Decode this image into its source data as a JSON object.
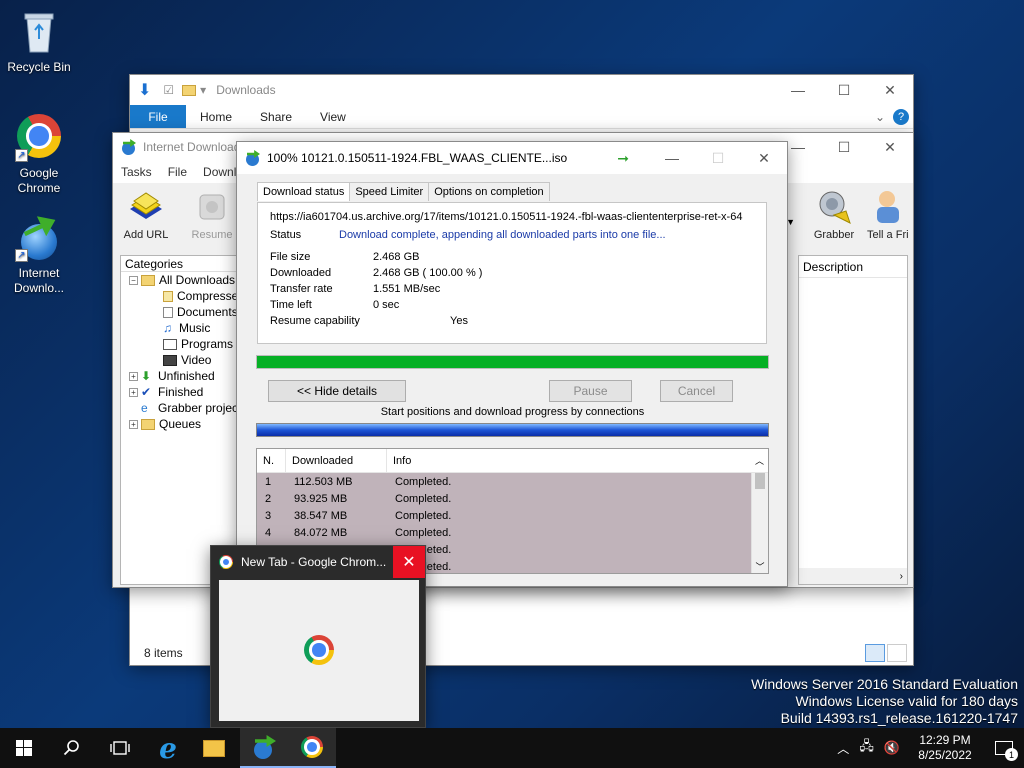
{
  "desktop": {
    "icons": [
      {
        "label": "Recycle Bin"
      },
      {
        "label": "Google Chrome"
      },
      {
        "label": "Internet Downlo..."
      }
    ]
  },
  "explorer": {
    "title": "Downloads",
    "ribbon": {
      "file": "File",
      "home": "Home",
      "share": "Share",
      "view": "View"
    },
    "status": "8 items"
  },
  "idm": {
    "title": "Internet Download",
    "menu": {
      "tasks": "Tasks",
      "file": "File",
      "downloads": "Downlo"
    },
    "toolbar": {
      "add_url": "Add URL",
      "resume": "Resume",
      "grabber": "Grabber",
      "tell_friend": "Tell a Fri"
    },
    "categories_label": "Categories",
    "tree": {
      "all": "All Downloads",
      "compressed": "Compresse",
      "documents": "Documents",
      "music": "Music",
      "programs": "Programs",
      "video": "Video",
      "unfinished": "Unfinished",
      "finished": "Finished",
      "grabber": "Grabber projec",
      "queues": "Queues"
    },
    "list_header": {
      "description": "Description"
    }
  },
  "dialog": {
    "title": "100% 10121.0.150511-1924.FBL_WAAS_CLIENTE...iso",
    "tabs": {
      "status": "Download status",
      "limiter": "Speed Limiter",
      "options": "Options on completion"
    },
    "url": "https://ia601704.us.archive.org/17/items/10121.0.150511-1924.-fbl-waas-cliententerprise-ret-x-64",
    "status_label": "Status",
    "status_value": "Download complete, appending all downloaded parts into one file...",
    "fields": {
      "file_size_label": "File size",
      "file_size_value": "2.468  GB",
      "downloaded_label": "Downloaded",
      "downloaded_value": "2.468  GB  ( 100.00 % )",
      "rate_label": "Transfer rate",
      "rate_value": "1.551  MB/sec",
      "time_label": "Time left",
      "time_value": "0 sec",
      "resume_label": "Resume capability",
      "resume_value": "Yes"
    },
    "progress": 1.0,
    "buttons": {
      "hide": "<< Hide details",
      "pause": "Pause",
      "cancel": "Cancel"
    },
    "connections_label": "Start positions and download progress by connections",
    "table": {
      "headers": {
        "n": "N.",
        "downloaded": "Downloaded",
        "info": "Info"
      },
      "rows": [
        {
          "n": "1",
          "downloaded": "112.503  MB",
          "info": "Completed."
        },
        {
          "n": "2",
          "downloaded": "93.925  MB",
          "info": "Completed."
        },
        {
          "n": "3",
          "downloaded": "38.547  MB",
          "info": "Completed."
        },
        {
          "n": "4",
          "downloaded": "84.072  MB",
          "info": "Completed."
        },
        {
          "n": "",
          "downloaded": "",
          "info": "Completed."
        },
        {
          "n": "",
          "downloaded": "",
          "info": "Completed."
        }
      ]
    }
  },
  "chrome_preview": {
    "title": "New Tab - Google Chrom..."
  },
  "watermark": {
    "line1": "Windows Server 2016 Standard Evaluation",
    "line2": "Windows License valid for 180 days",
    "line3": "Build 14393.rs1_release.161220-1747"
  },
  "taskbar": {
    "time": "12:29 PM",
    "date": "8/25/2022",
    "notification_count": "1"
  }
}
